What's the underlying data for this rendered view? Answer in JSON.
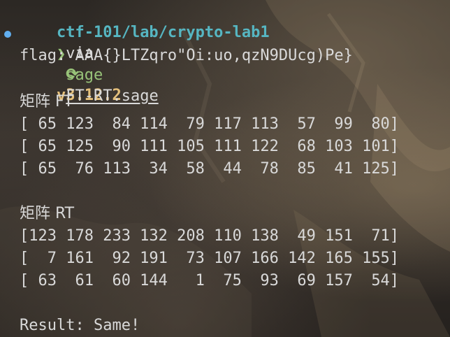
{
  "prompt": {
    "path": "ctf-101/lab/crypto-lab1",
    "via": "via",
    "python_icon": "python-icon",
    "version": "v3.12.2"
  },
  "command": {
    "chevron": "❯",
    "name": "sage",
    "arg": "FT-RT.sage"
  },
  "output": {
    "flag_line": "flag: AAA{}LTZqro\"Oi:uo,qzN9DUcg)Pe}",
    "ft_header": "矩阵 FT",
    "ft_rows": [
      "[ 65 123  84 114  79 117 113  57  99  80]",
      "[ 65 125  90 111 105 111 122  68 103 101]",
      "[ 65  76 113  34  58  44  78  85  41 125]"
    ],
    "rt_header": "矩阵 RT",
    "rt_rows": [
      "[123 178 233 132 208 110 138  49 151  71]",
      "[  7 161  92 191  73 107 166 142 165 155]",
      "[ 63  61  60 144   1  75  93  69 157  54]"
    ],
    "result": "Result: Same!"
  },
  "colors": {
    "path": "#56b6c2",
    "version": "#e5c07b",
    "prompt": "#98c379",
    "text": "#d9d9d9",
    "status_dot": "#61afef"
  }
}
